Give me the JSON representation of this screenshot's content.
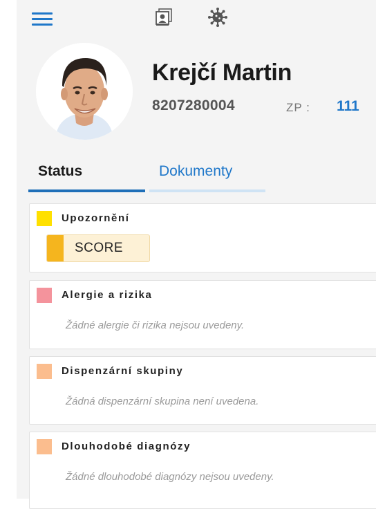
{
  "toolbar": {
    "menu_icon": "hamburger-menu-icon",
    "patient_card_icon": "patient-card-icon",
    "virus_icon": "virus-icon"
  },
  "patient": {
    "name": "Krejčí Martin",
    "id": "8207280004",
    "zp_label": "ZP :",
    "zp_value": "111"
  },
  "tabs": [
    {
      "label": "Status",
      "active": true
    },
    {
      "label": "Dokumenty",
      "active": false
    }
  ],
  "cards": {
    "warnings": {
      "title": "Upozornění",
      "color": "#ffe000",
      "badge": {
        "label": "SCORE",
        "color": "#f5b51e"
      }
    },
    "allergies": {
      "title": "Alergie a rizika",
      "color": "#f4939c",
      "empty": "Žádné alergie či rizika nejsou uvedeny."
    },
    "dispensary": {
      "title": "Dispenzární skupiny",
      "color": "#fbbd8e",
      "empty": "Žádná dispenzární skupina není uvedena."
    },
    "diagnoses": {
      "title": "Dlouhodobé diagnózy",
      "color": "#fbbd8e",
      "empty": "Žádné dlouhodobé diagnózy nejsou uvedeny."
    }
  },
  "colors": {
    "accent": "#1f77c9",
    "tab_active": "#1f6fb8",
    "tab_inactive": "#cfe3f4"
  }
}
